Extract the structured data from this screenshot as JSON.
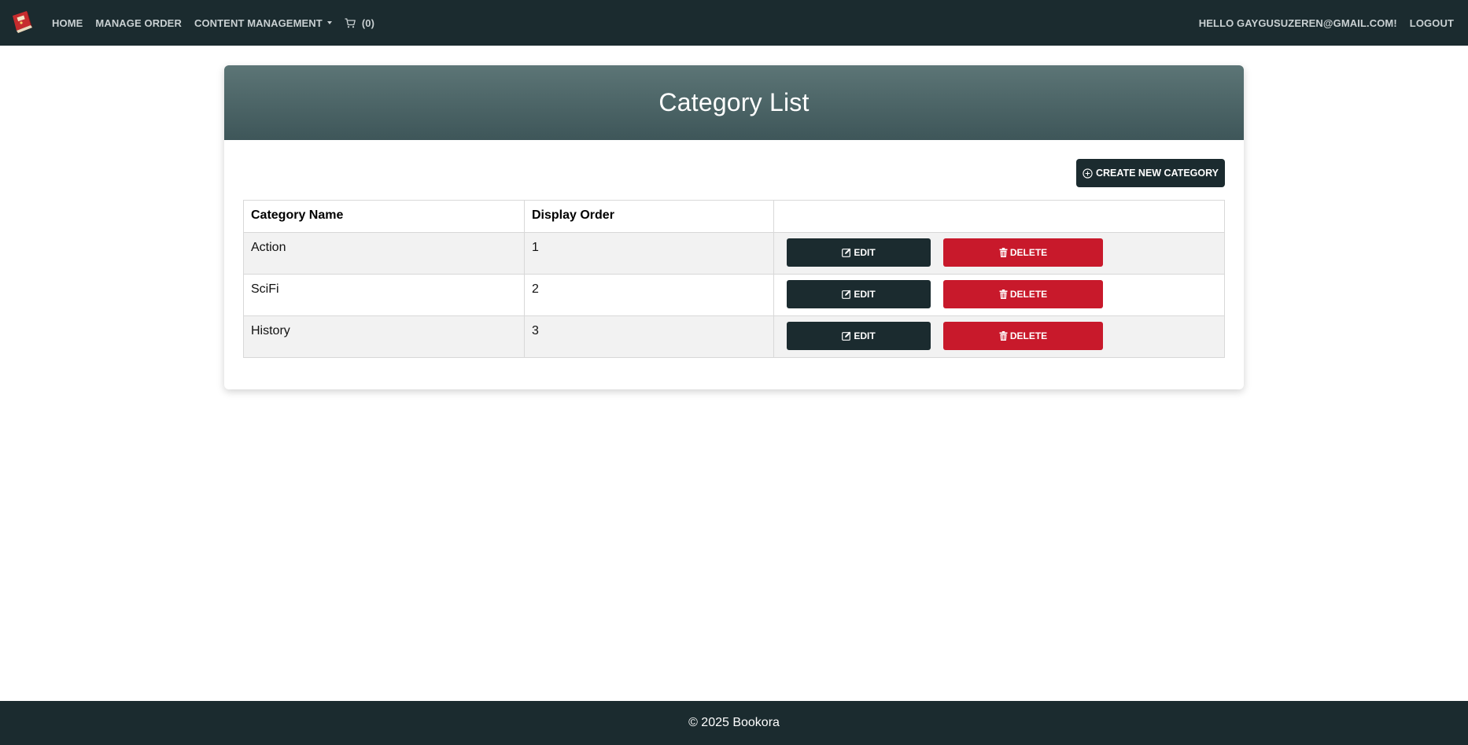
{
  "nav": {
    "logo_icon": "book-logo-icon",
    "home": "HOME",
    "manage_order": "MANAGE ORDER",
    "content_management": "CONTENT MANAGEMENT",
    "cart_count": "(0)",
    "greeting": "HELLO GAYGUSUZEREN@GMAIL.COM!",
    "logout": "LOGOUT"
  },
  "page": {
    "title": "Category List",
    "create_button": "CREATE NEW CATEGORY"
  },
  "table": {
    "headers": [
      "Category Name",
      "Display Order",
      ""
    ],
    "rows": [
      {
        "name": "Action",
        "order": "1"
      },
      {
        "name": "SciFi",
        "order": "2"
      },
      {
        "name": "History",
        "order": "3"
      }
    ],
    "edit_label": "EDIT",
    "delete_label": "DELETE"
  },
  "footer": {
    "text": "© 2025 Bookora"
  },
  "colors": {
    "navbar": "#1b2b2f",
    "header_gradient_top": "#5c7576",
    "header_gradient_bottom": "#3e5659",
    "edit_button": "#1b2b2f",
    "delete_button": "#c8192b"
  }
}
